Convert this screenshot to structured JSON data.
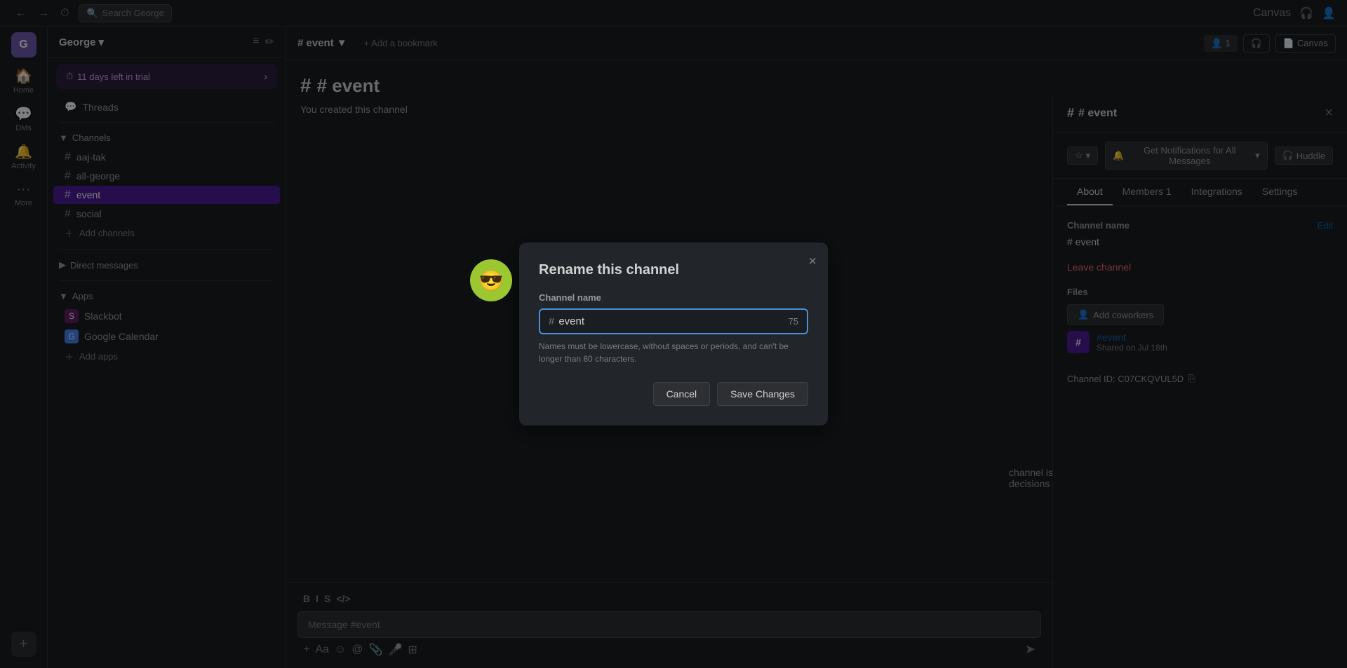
{
  "topbar": {
    "back_label": "←",
    "forward_label": "→",
    "history_label": "⏱",
    "search_placeholder": "Search George",
    "search_icon": "🔍",
    "user_icon": "👤"
  },
  "iconbar": {
    "workspace_initial": "G",
    "home_label": "Home",
    "dms_label": "DMs",
    "activity_label": "Activity",
    "more_label": "More",
    "add_label": "+"
  },
  "sidebar": {
    "workspace_name": "George",
    "trial_text": "11 days left in trial",
    "threads_label": "Threads",
    "channels_label": "Channels",
    "channels": [
      {
        "name": "aaj-tak",
        "active": false
      },
      {
        "name": "all-george",
        "active": false
      },
      {
        "name": "event",
        "active": true
      },
      {
        "name": "social",
        "active": false
      }
    ],
    "add_channels_label": "Add channels",
    "direct_messages_label": "Direct messages",
    "apps_label": "Apps",
    "apps": [
      {
        "name": "Slackbot",
        "icon": "S"
      },
      {
        "name": "Google Calendar",
        "icon": "G"
      }
    ],
    "add_apps_label": "Add apps"
  },
  "channel_header": {
    "title": "# event",
    "chevron": "▼"
  },
  "channel_panel": {
    "title": "# event",
    "close_icon": "×",
    "star_label": "☆",
    "notifications_label": "Get Notifications for All Messages",
    "chevron": "▾",
    "huddle_label": "Huddle",
    "huddle_icon": "🎧",
    "tabs": [
      "About",
      "Members 1",
      "Integrations",
      "Settings"
    ],
    "active_tab": "About",
    "channel_name_label": "Channel name",
    "channel_name_value": "# event",
    "edit_label": "Edit",
    "leave_channel_label": "Leave channel",
    "files_label": "Files",
    "add_coworkers_label": "Add coworkers",
    "file": {
      "name": "#event",
      "icon": "#",
      "date": "Shared on Jul 18th"
    },
    "channel_id_label": "Channel ID: C07CKQVUL5D",
    "copy_icon": "⎘"
  },
  "chat": {
    "channel_heading": "# event",
    "message_placeholder": "Message #event",
    "created_text": "You created this channel",
    "right_description": "channel is for everything #event. Hold meetings, share docs, and make decisions",
    "toolbar_bold": "B",
    "toolbar_italic": "I",
    "toolbar_strike": "S",
    "toolbar_code": "</>",
    "input_icon_attach": "+",
    "input_icon_aa": "Aa",
    "input_icon_emoji": "☺",
    "input_icon_at": "@",
    "input_icon_clip": "📎",
    "input_icon_mic": "🎤",
    "input_icon_layout": "⊞",
    "send_icon": "➤"
  },
  "modal": {
    "title": "Rename this channel",
    "close_icon": "×",
    "input_label": "Channel name",
    "input_prefix": "#",
    "input_value": "event",
    "char_count": "75",
    "hint": "Names must be lowercase, without spaces or periods, and can't be longer than 80 characters.",
    "cancel_label": "Cancel",
    "save_label": "Save Changes"
  },
  "header_right": {
    "canvas_label": "Canvas",
    "members_count": "1",
    "headset_label": "🎧",
    "user_icon": "👤"
  }
}
